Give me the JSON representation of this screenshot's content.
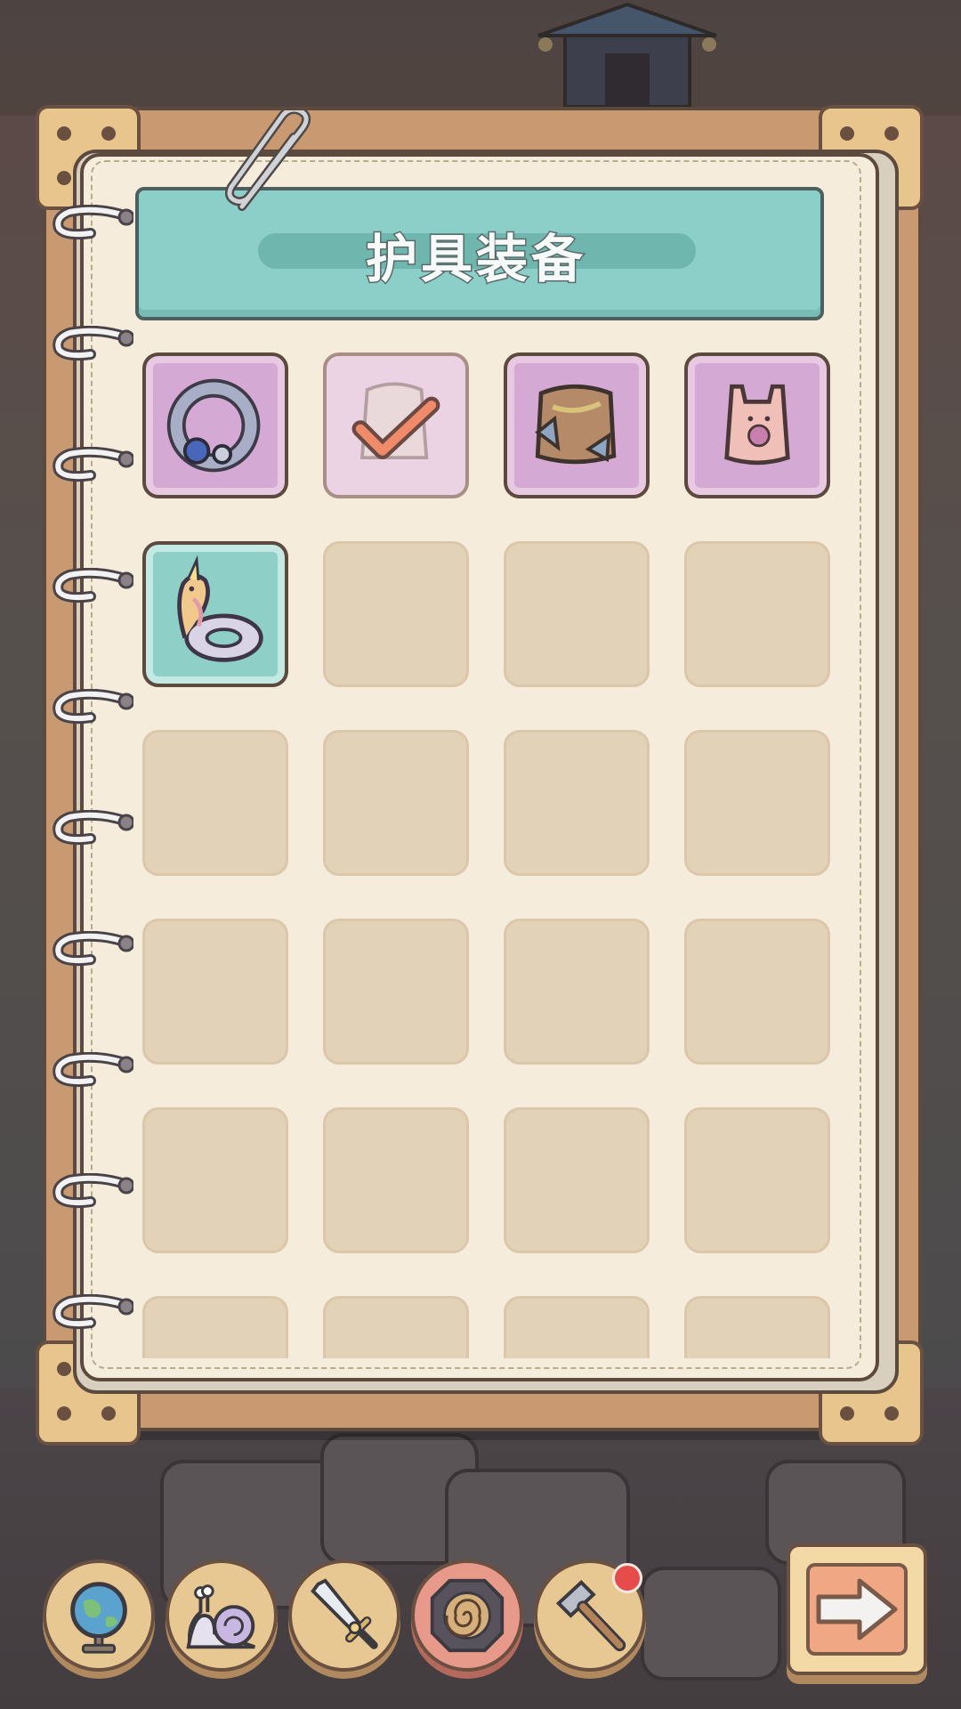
{
  "panel": {
    "title": "护具装备"
  },
  "slots": [
    {
      "state": "equipment",
      "icon": "ring-icon",
      "rarity_color": "#d4a9d3"
    },
    {
      "state": "equipped-selected",
      "icon": "scarf-armor-checkmark-icon",
      "rarity_color": "#ecd3e4"
    },
    {
      "state": "equipment",
      "icon": "leather-armor-icon",
      "rarity_color": "#d4a9d3"
    },
    {
      "state": "equipment",
      "icon": "pink-vest-icon",
      "rarity_color": "#d4a9d3"
    },
    {
      "state": "equipment",
      "icon": "unicorn-swim-ring-icon",
      "rarity_color": "#8ed0c8"
    },
    {
      "state": "empty"
    },
    {
      "state": "empty"
    },
    {
      "state": "empty"
    },
    {
      "state": "empty"
    },
    {
      "state": "empty"
    },
    {
      "state": "empty"
    },
    {
      "state": "empty"
    },
    {
      "state": "empty"
    },
    {
      "state": "empty"
    },
    {
      "state": "empty"
    },
    {
      "state": "empty"
    },
    {
      "state": "empty"
    },
    {
      "state": "empty"
    },
    {
      "state": "empty"
    },
    {
      "state": "empty"
    },
    {
      "state": "empty"
    },
    {
      "state": "empty"
    },
    {
      "state": "empty"
    },
    {
      "state": "empty"
    }
  ],
  "bottom_nav": [
    {
      "icon": "globe-icon"
    },
    {
      "icon": "snail-icon"
    },
    {
      "icon": "sword-icon",
      "active": false
    },
    {
      "icon": "shield-spiral-icon",
      "active": true
    },
    {
      "icon": "hammer-icon",
      "has_notification": true
    }
  ],
  "next_button": {
    "icon": "arrow-right-icon"
  },
  "colors": {
    "page": "#f5ecdc",
    "title_bar": "#8ccfc8",
    "empty_slot": "#e2d2b8",
    "notification": "#e74c4c"
  }
}
